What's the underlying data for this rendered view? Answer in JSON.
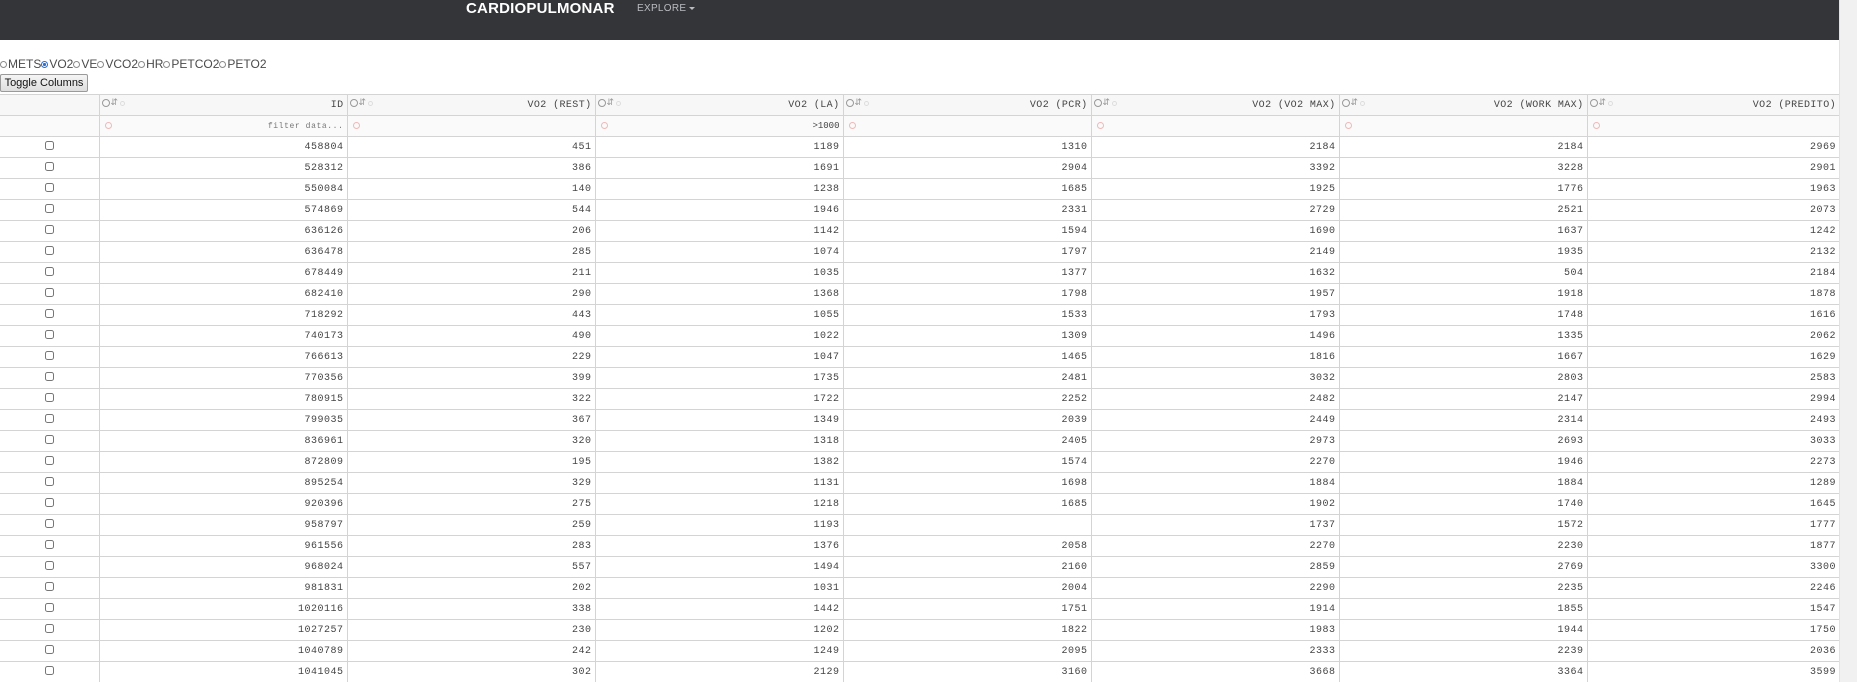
{
  "navbar": {
    "brand": "CARDIOPULMONAR",
    "explore": "EXPLORE"
  },
  "metric_options": [
    {
      "label": "METS",
      "selected": false
    },
    {
      "label": "VO2",
      "selected": true
    },
    {
      "label": "VE",
      "selected": false
    },
    {
      "label": "VCO2",
      "selected": false
    },
    {
      "label": "HR",
      "selected": false
    },
    {
      "label": "PETCO2",
      "selected": false
    },
    {
      "label": "PETO2",
      "selected": false
    }
  ],
  "toggle_label": "Toggle Columns",
  "columns": [
    "ID",
    "VO2 (REST)",
    "VO2 (LA)",
    "VO2 (PCR)",
    "VO2 (VO2 MAX)",
    "VO2 (WORK MAX)",
    "VO2 (PREDITO)"
  ],
  "filters": [
    "filter data...",
    "",
    ">1000",
    "",
    "",
    "",
    ""
  ],
  "rows": [
    [
      "458804",
      "451",
      "1189",
      "1310",
      "2184",
      "2184",
      "2969"
    ],
    [
      "528312",
      "386",
      "1691",
      "2904",
      "3392",
      "3228",
      "2901"
    ],
    [
      "550084",
      "140",
      "1238",
      "1685",
      "1925",
      "1776",
      "1963"
    ],
    [
      "574869",
      "544",
      "1946",
      "2331",
      "2729",
      "2521",
      "2073"
    ],
    [
      "636126",
      "206",
      "1142",
      "1594",
      "1690",
      "1637",
      "1242"
    ],
    [
      "636478",
      "285",
      "1074",
      "1797",
      "2149",
      "1935",
      "2132"
    ],
    [
      "678449",
      "211",
      "1035",
      "1377",
      "1632",
      "504",
      "2184"
    ],
    [
      "682410",
      "290",
      "1368",
      "1798",
      "1957",
      "1918",
      "1878"
    ],
    [
      "718292",
      "443",
      "1055",
      "1533",
      "1793",
      "1748",
      "1616"
    ],
    [
      "740173",
      "490",
      "1022",
      "1309",
      "1496",
      "1335",
      "2062"
    ],
    [
      "766613",
      "229",
      "1047",
      "1465",
      "1816",
      "1667",
      "1629"
    ],
    [
      "770356",
      "399",
      "1735",
      "2481",
      "3032",
      "2803",
      "2583"
    ],
    [
      "780915",
      "322",
      "1722",
      "2252",
      "2482",
      "2147",
      "2994"
    ],
    [
      "799035",
      "367",
      "1349",
      "2039",
      "2449",
      "2314",
      "2493"
    ],
    [
      "836961",
      "320",
      "1318",
      "2405",
      "2973",
      "2693",
      "3033"
    ],
    [
      "872809",
      "195",
      "1382",
      "1574",
      "2270",
      "1946",
      "2273"
    ],
    [
      "895254",
      "329",
      "1131",
      "1698",
      "1884",
      "1884",
      "1289"
    ],
    [
      "920396",
      "275",
      "1218",
      "1685",
      "1902",
      "1740",
      "1645"
    ],
    [
      "958797",
      "259",
      "1193",
      "",
      "1737",
      "1572",
      "1777"
    ],
    [
      "961556",
      "283",
      "1376",
      "2058",
      "2270",
      "2230",
      "1877"
    ],
    [
      "968024",
      "557",
      "1494",
      "2160",
      "2859",
      "2769",
      "3300"
    ],
    [
      "981831",
      "202",
      "1031",
      "2004",
      "2290",
      "2235",
      "2246"
    ],
    [
      "1020116",
      "338",
      "1442",
      "1751",
      "1914",
      "1855",
      "1547"
    ],
    [
      "1027257",
      "230",
      "1202",
      "1822",
      "1983",
      "1944",
      "1750"
    ],
    [
      "1040789",
      "242",
      "1249",
      "2095",
      "2333",
      "2239",
      "2036"
    ],
    [
      "1041045",
      "302",
      "2129",
      "3160",
      "3668",
      "3364",
      "3599"
    ]
  ],
  "colors": {
    "navbar_bg": "#333539",
    "radio_selected": "#2a6fd6",
    "grid_line": "#d4d4d4"
  }
}
